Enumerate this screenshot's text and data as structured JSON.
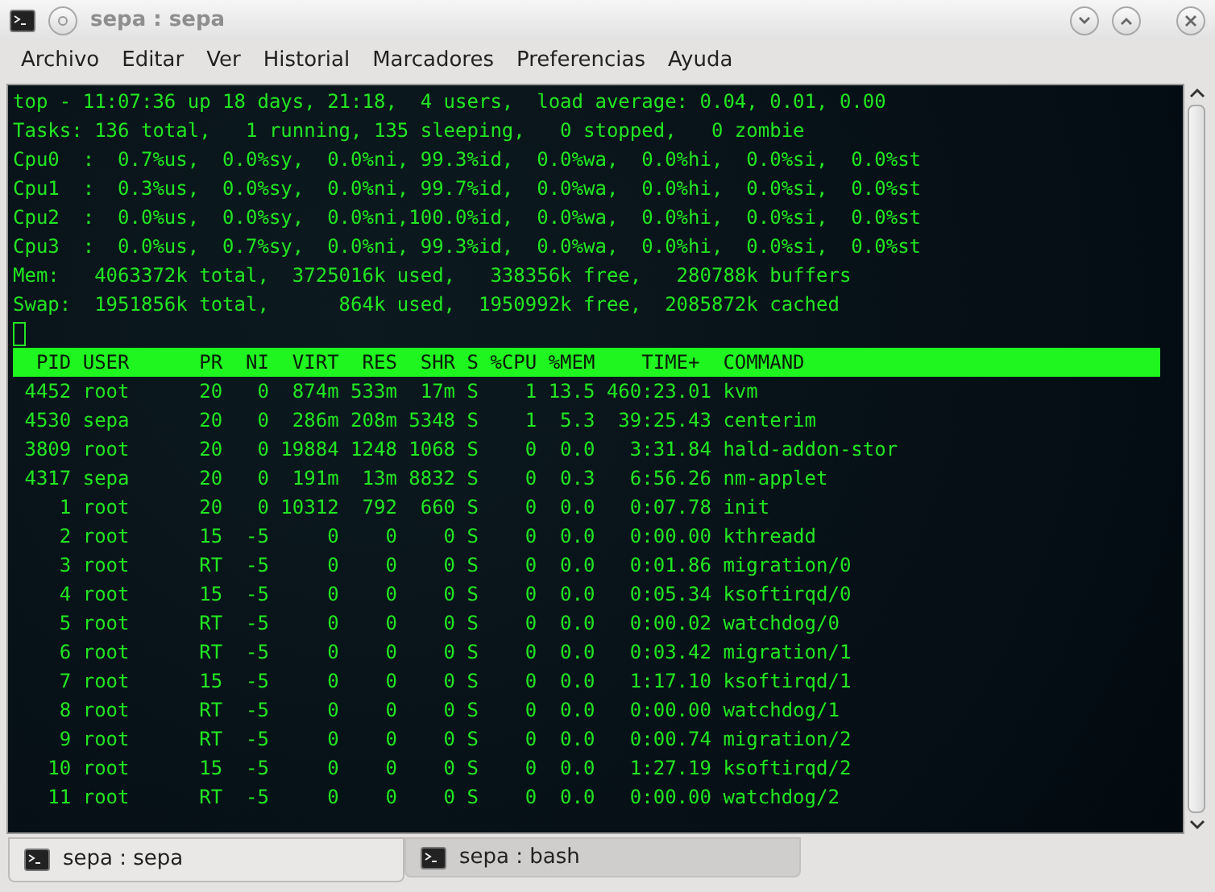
{
  "window": {
    "title": "sepa : sepa"
  },
  "menu": [
    "Archivo",
    "Editar",
    "Ver",
    "Historial",
    "Marcadores",
    "Preferencias",
    "Ayuda"
  ],
  "terminal": {
    "summary": [
      "top - 11:07:36 up 18 days, 21:18,  4 users,  load average: 0.04, 0.01, 0.00",
      "Tasks: 136 total,   1 running, 135 sleeping,   0 stopped,   0 zombie",
      "Cpu0  :  0.7%us,  0.0%sy,  0.0%ni, 99.3%id,  0.0%wa,  0.0%hi,  0.0%si,  0.0%st",
      "Cpu1  :  0.3%us,  0.0%sy,  0.0%ni, 99.7%id,  0.0%wa,  0.0%hi,  0.0%si,  0.0%st",
      "Cpu2  :  0.0%us,  0.0%sy,  0.0%ni,100.0%id,  0.0%wa,  0.0%hi,  0.0%si,  0.0%st",
      "Cpu3  :  0.0%us,  0.7%sy,  0.0%ni, 99.3%id,  0.0%wa,  0.0%hi,  0.0%si,  0.0%st",
      "Mem:   4063372k total,  3725016k used,   338356k free,   280788k buffers",
      "Swap:  1951856k total,      864k used,  1950992k free,  2085872k cached"
    ],
    "header": "  PID USER      PR  NI  VIRT  RES  SHR S %CPU %MEM    TIME+  COMMAND",
    "rows": [
      " 4452 root      20   0  874m 533m  17m S    1 13.5 460:23.01 kvm",
      " 4530 sepa      20   0  286m 208m 5348 S    1  5.3  39:25.43 centerim",
      " 3809 root      20   0 19884 1248 1068 S    0  0.0   3:31.84 hald-addon-stor",
      " 4317 sepa      20   0  191m  13m 8832 S    0  0.3   6:56.26 nm-applet",
      "    1 root      20   0 10312  792  660 S    0  0.0   0:07.78 init",
      "    2 root      15  -5     0    0    0 S    0  0.0   0:00.00 kthreadd",
      "    3 root      RT  -5     0    0    0 S    0  0.0   0:01.86 migration/0",
      "    4 root      15  -5     0    0    0 S    0  0.0   0:05.34 ksoftirqd/0",
      "    5 root      RT  -5     0    0    0 S    0  0.0   0:00.02 watchdog/0",
      "    6 root      RT  -5     0    0    0 S    0  0.0   0:03.42 migration/1",
      "    7 root      15  -5     0    0    0 S    0  0.0   1:17.10 ksoftirqd/1",
      "    8 root      RT  -5     0    0    0 S    0  0.0   0:00.00 watchdog/1",
      "    9 root      RT  -5     0    0    0 S    0  0.0   0:00.74 migration/2",
      "   10 root      15  -5     0    0    0 S    0  0.0   1:27.19 ksoftirqd/2",
      "   11 root      RT  -5     0    0    0 S    0  0.0   0:00.00 watchdog/2"
    ]
  },
  "tabs": [
    {
      "label": "sepa : sepa",
      "selected": true
    },
    {
      "label": "sepa : bash",
      "selected": false
    }
  ]
}
